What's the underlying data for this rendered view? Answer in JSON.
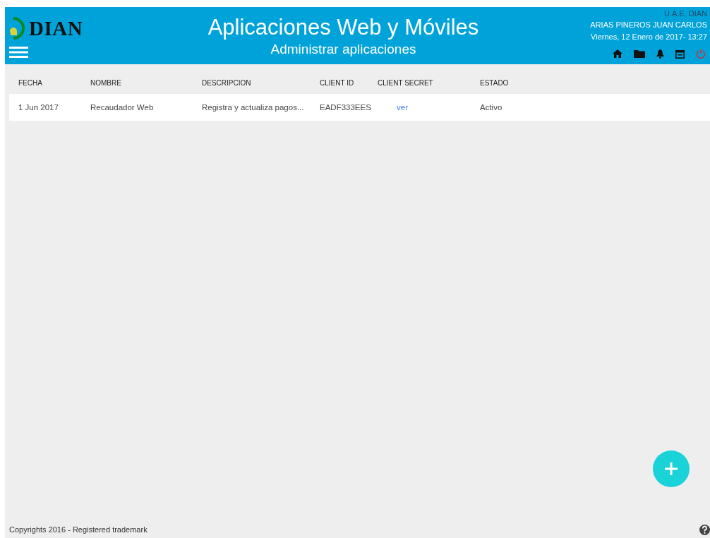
{
  "header": {
    "brand": "DIAN",
    "title": "Aplicaciones Web y Móviles",
    "subtitle": "Administrar aplicaciones",
    "organization": "U.A.E. DIAN",
    "user": "ARIAS PINEROS JUAN CARLOS",
    "datetime": "Viernes, 12 Enero de 2017- 13:27"
  },
  "table": {
    "columns": [
      "FECHA",
      "NOMBRE",
      "DESCRIPCION",
      "CLIENT ID",
      "CLIENT SECRET",
      "ESTADO"
    ],
    "rows": [
      {
        "fecha": "1 Jun 2017",
        "nombre": "Recaudador Web",
        "descripcion": "Registra y actualiza pagos...",
        "client_id": "EADF333EES",
        "client_secret": "ver",
        "estado": "Activo"
      }
    ]
  },
  "footer": {
    "text": "Copyrights 2016 - Registered trademark"
  }
}
